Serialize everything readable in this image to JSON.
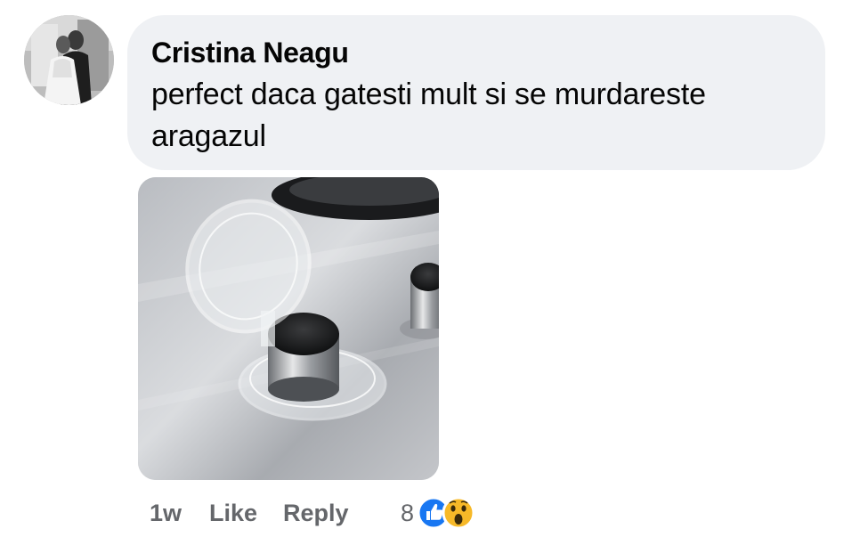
{
  "comment": {
    "author": "Cristina Neagu",
    "text": "perfect daca gatesti mult si se murdareste aragazul",
    "time": "1w",
    "like_label": "Like",
    "reply_label": "Reply",
    "reaction_count": "8",
    "reactions": [
      "like-icon",
      "wow-icon"
    ]
  },
  "colors": {
    "bubble": "#eff1f4",
    "like_blue": "#1877f2",
    "wow_yellow": "#f7b928",
    "action_text": "#65676b"
  }
}
